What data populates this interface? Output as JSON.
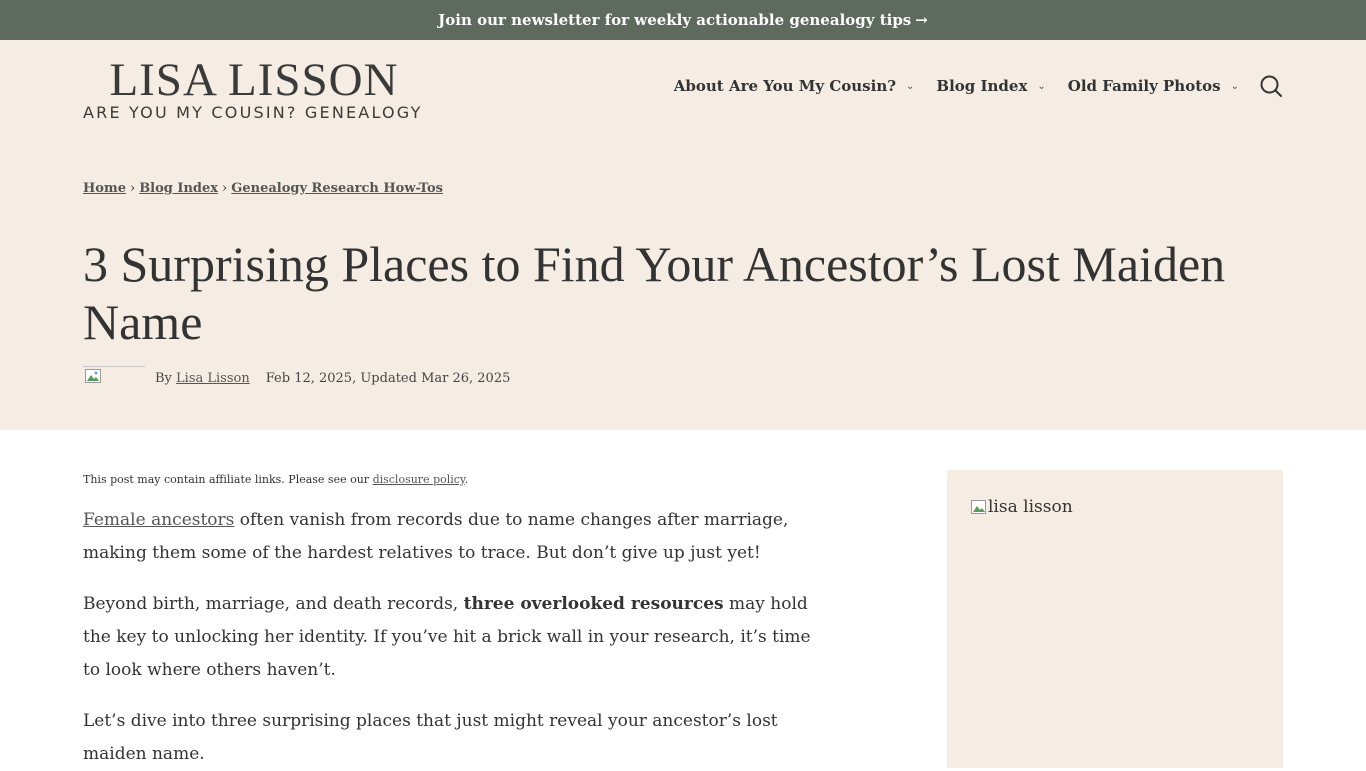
{
  "colors": {
    "topbar_bg": "#5e6a5e",
    "hero_bg": "#f5ede3",
    "sidebar_bg": "#f5ede3",
    "text": "#333333",
    "link": "#555555"
  },
  "topbar": {
    "text": "Join our newsletter for weekly actionable genealogy tips",
    "arrow": "→"
  },
  "logo": {
    "name": "LISA LISSON",
    "tagline": "ARE YOU MY COUSIN? GENEALOGY"
  },
  "nav": {
    "items": [
      {
        "label": "About Are You My Cousin?",
        "icon": "chevron-down-icon"
      },
      {
        "label": "Blog Index",
        "icon": "chevron-down-icon"
      },
      {
        "label": "Old Family Photos",
        "icon": "chevron-down-icon"
      }
    ],
    "search_icon": "search-icon"
  },
  "breadcrumb": {
    "items": [
      "Home",
      "Blog Index",
      "Genealogy Research How-Tos"
    ],
    "separator": "›"
  },
  "article": {
    "title": "3 Surprising Places to Find Your Ancestor’s Lost Maiden Name",
    "by_prefix": "By",
    "author": "Lisa Lisson",
    "dates": "Feb 12, 2025, Updated Mar 26, 2025",
    "affiliate_prefix": "This post may contain affiliate links. Please see our",
    "affiliate_link": "disclosure policy",
    "affiliate_suffix": ".",
    "p1_link": "Female ancestors",
    "p1_text": " often vanish from records due to name changes after marriage, making them some of the hardest relatives to trace. But don’t give up just yet!",
    "p2_before": "Beyond birth, marriage, and death records, ",
    "p2_bold": "three overlooked resources",
    "p2_after": " may hold the key to unlocking her identity. If you’ve hit a brick wall in your research, it’s time to look where others haven’t.",
    "p3_text": "Let’s dive into three surprising places that just might reveal your ancestor’s lost maiden name."
  },
  "sidebar": {
    "image_alt": "lisa lisson"
  }
}
